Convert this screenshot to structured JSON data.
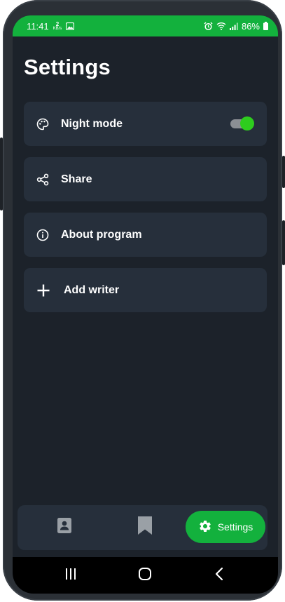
{
  "status_bar": {
    "time": "11:41",
    "net_speed_value": "2",
    "net_speed_unit": "KB/s",
    "battery": "86%"
  },
  "page": {
    "title": "Settings"
  },
  "items": [
    {
      "label": "Night mode",
      "icon": "palette-icon",
      "toggle_on": true
    },
    {
      "label": "Share",
      "icon": "share-icon"
    },
    {
      "label": "About program",
      "icon": "info-icon"
    },
    {
      "label": "Add writer",
      "icon": "plus-icon"
    }
  ],
  "bottom_nav": {
    "items": [
      {
        "icon": "contact-card-icon",
        "active": false
      },
      {
        "icon": "bookmark-icon",
        "active": false
      },
      {
        "icon": "gear-icon",
        "label": "Settings",
        "active": true
      }
    ]
  },
  "system_nav": [
    "recent-apps-icon",
    "home-icon",
    "back-icon"
  ],
  "colors": {
    "accent": "#13b13d",
    "toggle_on": "#2ecc1e",
    "background": "#1c222a",
    "card": "#262f3b",
    "inactive_icon": "#9aa0a6"
  }
}
